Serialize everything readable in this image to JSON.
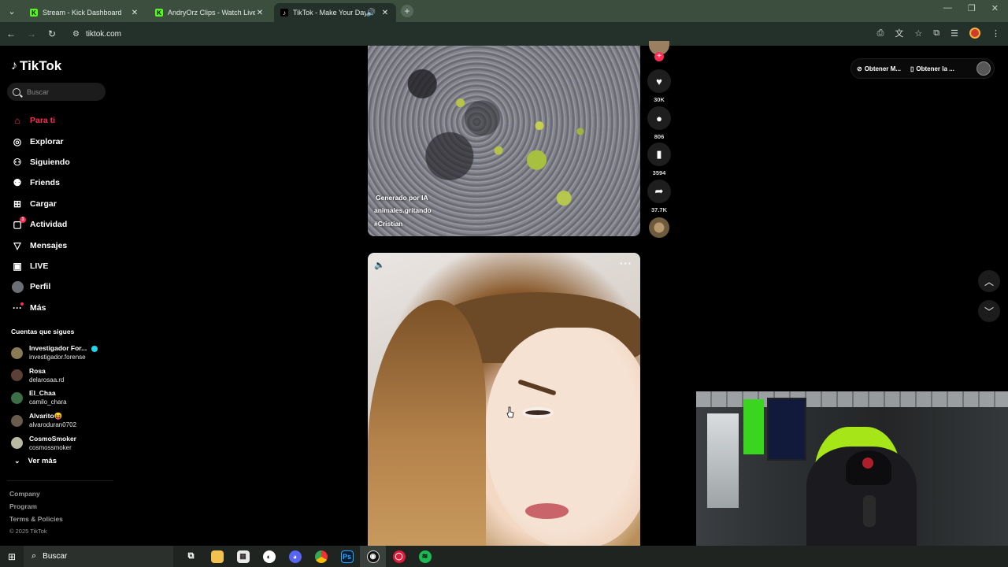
{
  "browser": {
    "tabs": [
      {
        "title": "Stream - Kick Dashboard",
        "favicon": "K"
      },
      {
        "title": "AndryOrz Clips - Watch Live on",
        "favicon": "K"
      },
      {
        "title": "TikTok - Make Your Day",
        "favicon": "♪",
        "active": true
      }
    ],
    "url": "tiktok.com"
  },
  "tiktok": {
    "logo": "TikTok",
    "search_placeholder": "Buscar",
    "nav": [
      {
        "label": "Para ti",
        "icon": "home-icon",
        "active": true
      },
      {
        "label": "Explorar",
        "icon": "compass-icon"
      },
      {
        "label": "Siguiendo",
        "icon": "following-icon"
      },
      {
        "label": "Friends",
        "icon": "friends-icon"
      },
      {
        "label": "Cargar",
        "icon": "upload-icon"
      },
      {
        "label": "Actividad",
        "icon": "activity-icon",
        "badge": "1"
      },
      {
        "label": "Mensajes",
        "icon": "messages-icon"
      },
      {
        "label": "LIVE",
        "icon": "live-icon"
      },
      {
        "label": "Perfil",
        "icon": "profile-avatar"
      },
      {
        "label": "Más",
        "icon": "more-icon"
      }
    ],
    "following_title": "Cuentas que sigues",
    "following": [
      {
        "name": "Investigador For...",
        "handle": "investigador.forense",
        "verified": true
      },
      {
        "name": "Rosa",
        "handle": "delarosaa.rd"
      },
      {
        "name": "El_Chaa",
        "handle": "camilo_chara"
      },
      {
        "name": "Alvarito😝",
        "handle": "alvaroduran0702"
      },
      {
        "name": "CosmoSmoker",
        "handle": "cosmossmoker"
      }
    ],
    "see_more": "Ver más",
    "footer": [
      "Company",
      "Program",
      "Terms & Policies"
    ],
    "copyright": "© 2025 TikTok",
    "video1": {
      "ai_label": "Generado por IA",
      "author": "animales.gritando",
      "hashtag": "#Cristian"
    },
    "actions": {
      "likes": "30K",
      "comments": "806",
      "saves": "3594",
      "shares": "37.7K"
    },
    "top_buttons": [
      "Obtener M...",
      "Obtener la ..."
    ]
  },
  "taskbar": {
    "search_label": "Buscar",
    "apps": [
      "task-view-icon",
      "file-explorer-icon",
      "store-icon",
      "app-circle-icon",
      "discord-icon",
      "chrome-icon",
      "photoshop-icon",
      "obs-icon",
      "opera-icon",
      "spotify-icon"
    ]
  },
  "colors": {
    "accent": "#fe2c55",
    "chrome_frame": "#3c4f3e",
    "kick_green": "#53fc18"
  }
}
